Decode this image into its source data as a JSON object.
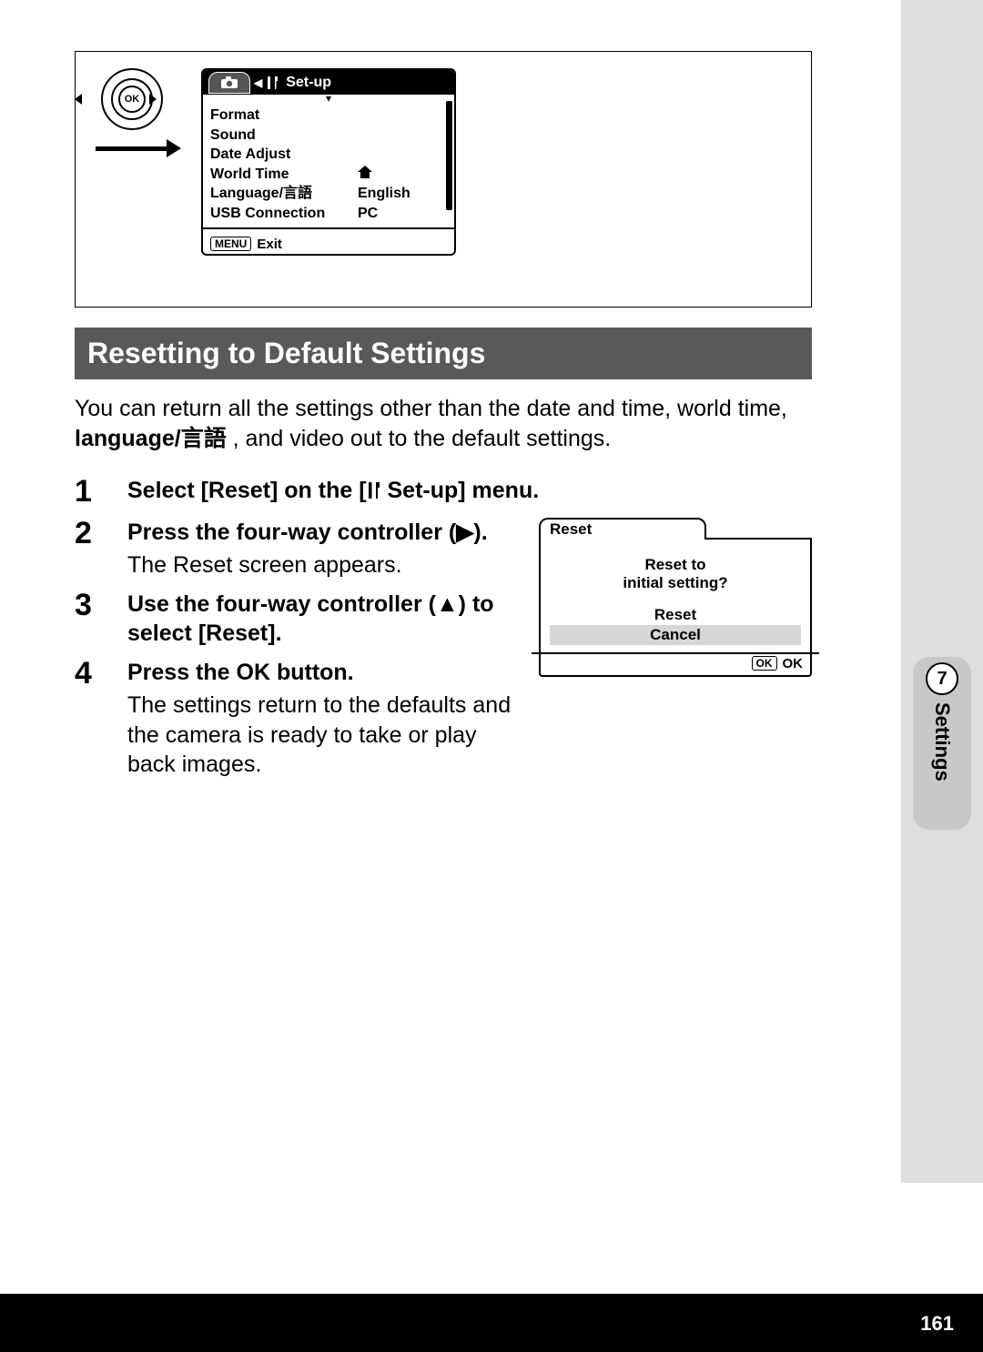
{
  "sidebar": {
    "chapter_num": "7",
    "chapter_label": "Settings"
  },
  "footer": {
    "page": "161"
  },
  "setup_menu": {
    "ok_label": "OK",
    "tab_title": "Set-up",
    "items": [
      {
        "k": "Format",
        "v": ""
      },
      {
        "k": "Sound",
        "v": ""
      },
      {
        "k": "Date Adjust",
        "v": ""
      },
      {
        "k": "World Time",
        "v": "",
        "icon": "home"
      },
      {
        "k": "Language/",
        "k2": "言語",
        "v": "English"
      },
      {
        "k": "USB Connection",
        "v": "PC"
      }
    ],
    "exit_badge": "MENU",
    "exit_label": "Exit"
  },
  "section": {
    "title": "Resetting to Default Settings"
  },
  "intro": {
    "t1": "You can return all the settings other than the date and time, world time, ",
    "bold": "language/",
    "lang": "言語",
    "t2": " , and video out to the default settings."
  },
  "steps": [
    {
      "n": "1",
      "h1": "Select [Reset] on the [",
      "h2": " Set-up] menu."
    },
    {
      "n": "2",
      "h": "Press the four-way controller (▶).",
      "d": "The Reset screen appears."
    },
    {
      "n": "3",
      "h": "Use the four-way controller (▲) to select [Reset]."
    },
    {
      "n": "4",
      "h": "Press the OK button.",
      "d": "The settings return to the defaults and the camera is ready to take or play back images."
    }
  ],
  "reset": {
    "tab": "Reset",
    "q1": "Reset to",
    "q2": "initial setting?",
    "opt_reset": "Reset",
    "opt_cancel": "Cancel",
    "ok_badge": "OK",
    "ok_label": "OK"
  }
}
